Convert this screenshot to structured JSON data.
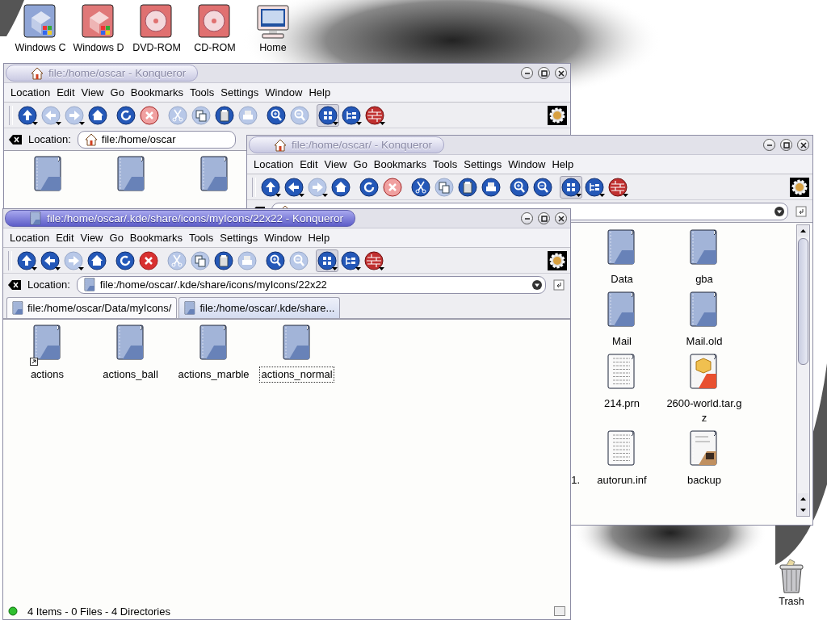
{
  "desktop_icons": [
    {
      "kind": "windows-drive",
      "label": "Windows C",
      "color": "#8fa5d6"
    },
    {
      "kind": "windows-drive",
      "label": "Windows D",
      "color": "#e07878"
    },
    {
      "kind": "disc",
      "label": "DVD-ROM"
    },
    {
      "kind": "disc",
      "label": "CD-ROM"
    },
    {
      "kind": "monitor",
      "label": "Home"
    }
  ],
  "trash": {
    "label": "Trash"
  },
  "windows": [
    {
      "title": "file:/home/oscar - Konqueror",
      "active": false,
      "menu": [
        "Location",
        "Edit",
        "View",
        "Go",
        "Bookmarks",
        "Tools",
        "Settings",
        "Window",
        "Help"
      ],
      "toolbar": [
        {
          "kind": "up",
          "disabled": false,
          "selected": false,
          "menu": true
        },
        {
          "kind": "back",
          "disabled": true,
          "selected": false,
          "menu": true
        },
        {
          "kind": "forward",
          "disabled": true,
          "selected": false,
          "menu": true
        },
        {
          "kind": "home",
          "disabled": false,
          "selected": false,
          "menu": false
        },
        {
          "kind": "reload",
          "disabled": false,
          "selected": false,
          "menu": false
        },
        {
          "kind": "stop",
          "disabled": true,
          "selected": false,
          "menu": false
        },
        {
          "kind": "cut",
          "disabled": true,
          "selected": false,
          "menu": false
        },
        {
          "kind": "copy",
          "disabled": true,
          "selected": false,
          "menu": false
        },
        {
          "kind": "paste",
          "disabled": false,
          "selected": false,
          "menu": false
        },
        {
          "kind": "print",
          "disabled": true,
          "selected": false,
          "menu": false
        },
        {
          "kind": "zoomin",
          "disabled": false,
          "selected": false,
          "menu": false
        },
        {
          "kind": "zoomout",
          "disabled": true,
          "selected": false,
          "menu": false
        },
        {
          "kind": "iconview",
          "disabled": false,
          "selected": true,
          "menu": true
        },
        {
          "kind": "treeview",
          "disabled": false,
          "selected": false,
          "menu": true
        },
        {
          "kind": "konsole",
          "disabled": false,
          "selected": false,
          "menu": true
        }
      ],
      "location": {
        "label": "Location:",
        "value": "file:/home/oscar"
      },
      "files": [
        {
          "kind": "folder"
        },
        {
          "kind": "folder"
        },
        {
          "kind": "folder"
        }
      ]
    },
    {
      "title": "file:/home/oscar/ - Konqueror",
      "active": false,
      "menu": [
        "Location",
        "Edit",
        "View",
        "Go",
        "Bookmarks",
        "Tools",
        "Settings",
        "Window",
        "Help"
      ],
      "toolbar": [
        {
          "kind": "up",
          "disabled": false,
          "selected": false,
          "menu": true
        },
        {
          "kind": "back",
          "disabled": false,
          "selected": false,
          "menu": true
        },
        {
          "kind": "forward",
          "disabled": true,
          "selected": false,
          "menu": true
        },
        {
          "kind": "home",
          "disabled": false,
          "selected": false,
          "menu": false
        },
        {
          "kind": "reload",
          "disabled": false,
          "selected": false,
          "menu": false
        },
        {
          "kind": "stop",
          "disabled": true,
          "selected": false,
          "menu": false
        },
        {
          "kind": "cut",
          "disabled": false,
          "selected": false,
          "menu": false
        },
        {
          "kind": "copy",
          "disabled": true,
          "selected": false,
          "menu": false
        },
        {
          "kind": "paste",
          "disabled": false,
          "selected": false,
          "menu": false
        },
        {
          "kind": "print",
          "disabled": false,
          "selected": false,
          "menu": false
        },
        {
          "kind": "zoomin",
          "disabled": false,
          "selected": false,
          "menu": false
        },
        {
          "kind": "zoomout",
          "disabled": false,
          "selected": false,
          "menu": false
        },
        {
          "kind": "iconview",
          "disabled": false,
          "selected": true,
          "menu": true
        },
        {
          "kind": "treeview",
          "disabled": false,
          "selected": false,
          "menu": true
        },
        {
          "kind": "konsole",
          "disabled": false,
          "selected": false,
          "menu": true
        }
      ],
      "scrollbar": true,
      "files": [
        {
          "kind": "folder",
          "name": "Data"
        },
        {
          "kind": "folder",
          "name": "gba"
        },
        {
          "kind": "folder",
          "name": "Mail"
        },
        {
          "kind": "folder",
          "name": "Mail.old"
        },
        {
          "kind": "text",
          "name": "214.prn"
        },
        {
          "kind": "archive",
          "name": "2600-world.tar.gz"
        },
        {
          "kind": "fragment",
          "name": "1."
        },
        {
          "kind": "text",
          "name": "autorun.inf"
        },
        {
          "kind": "script",
          "name": "backup"
        }
      ]
    },
    {
      "title": "file:/home/oscar/.kde/share/icons/myIcons/22x22 - Konqueror",
      "active": true,
      "menu": [
        "Location",
        "Edit",
        "View",
        "Go",
        "Bookmarks",
        "Tools",
        "Settings",
        "Window",
        "Help"
      ],
      "toolbar": [
        {
          "kind": "up",
          "disabled": false,
          "selected": false,
          "menu": true
        },
        {
          "kind": "back",
          "disabled": false,
          "selected": false,
          "menu": true
        },
        {
          "kind": "forward",
          "disabled": true,
          "selected": false,
          "menu": true
        },
        {
          "kind": "home",
          "disabled": false,
          "selected": false,
          "menu": false
        },
        {
          "kind": "reload",
          "disabled": false,
          "selected": false,
          "menu": false
        },
        {
          "kind": "stop",
          "disabled": false,
          "selected": false,
          "menu": false
        },
        {
          "kind": "cut",
          "disabled": true,
          "selected": false,
          "menu": false
        },
        {
          "kind": "copy",
          "disabled": true,
          "selected": false,
          "menu": false
        },
        {
          "kind": "paste",
          "disabled": false,
          "selected": false,
          "menu": false
        },
        {
          "kind": "print",
          "disabled": true,
          "selected": false,
          "menu": false
        },
        {
          "kind": "zoomin",
          "disabled": false,
          "selected": false,
          "menu": false
        },
        {
          "kind": "zoomout",
          "disabled": true,
          "selected": false,
          "menu": false
        },
        {
          "kind": "iconview",
          "disabled": false,
          "selected": true,
          "menu": true
        },
        {
          "kind": "treeview",
          "disabled": false,
          "selected": false,
          "menu": true
        },
        {
          "kind": "konsole",
          "disabled": false,
          "selected": false,
          "menu": true
        }
      ],
      "location": {
        "label": "Location:",
        "value": "file:/home/oscar/.kde/share/icons/myIcons/22x22"
      },
      "tabs": [
        {
          "label": "file:/home/oscar/Data/myIcons/",
          "selected": false
        },
        {
          "label": "file:/home/oscar/.kde/share...",
          "selected": true
        }
      ],
      "files": [
        {
          "kind": "folder",
          "name": "actions",
          "link": true,
          "focused": false
        },
        {
          "kind": "folder",
          "name": "actions_ball",
          "link": false,
          "focused": false
        },
        {
          "kind": "folder",
          "name": "actions_marble",
          "link": false,
          "focused": false
        },
        {
          "kind": "folder",
          "name": "actions_normal",
          "link": false,
          "focused": true
        }
      ],
      "status": "4 Items - 0 Files - 4 Directories"
    }
  ]
}
